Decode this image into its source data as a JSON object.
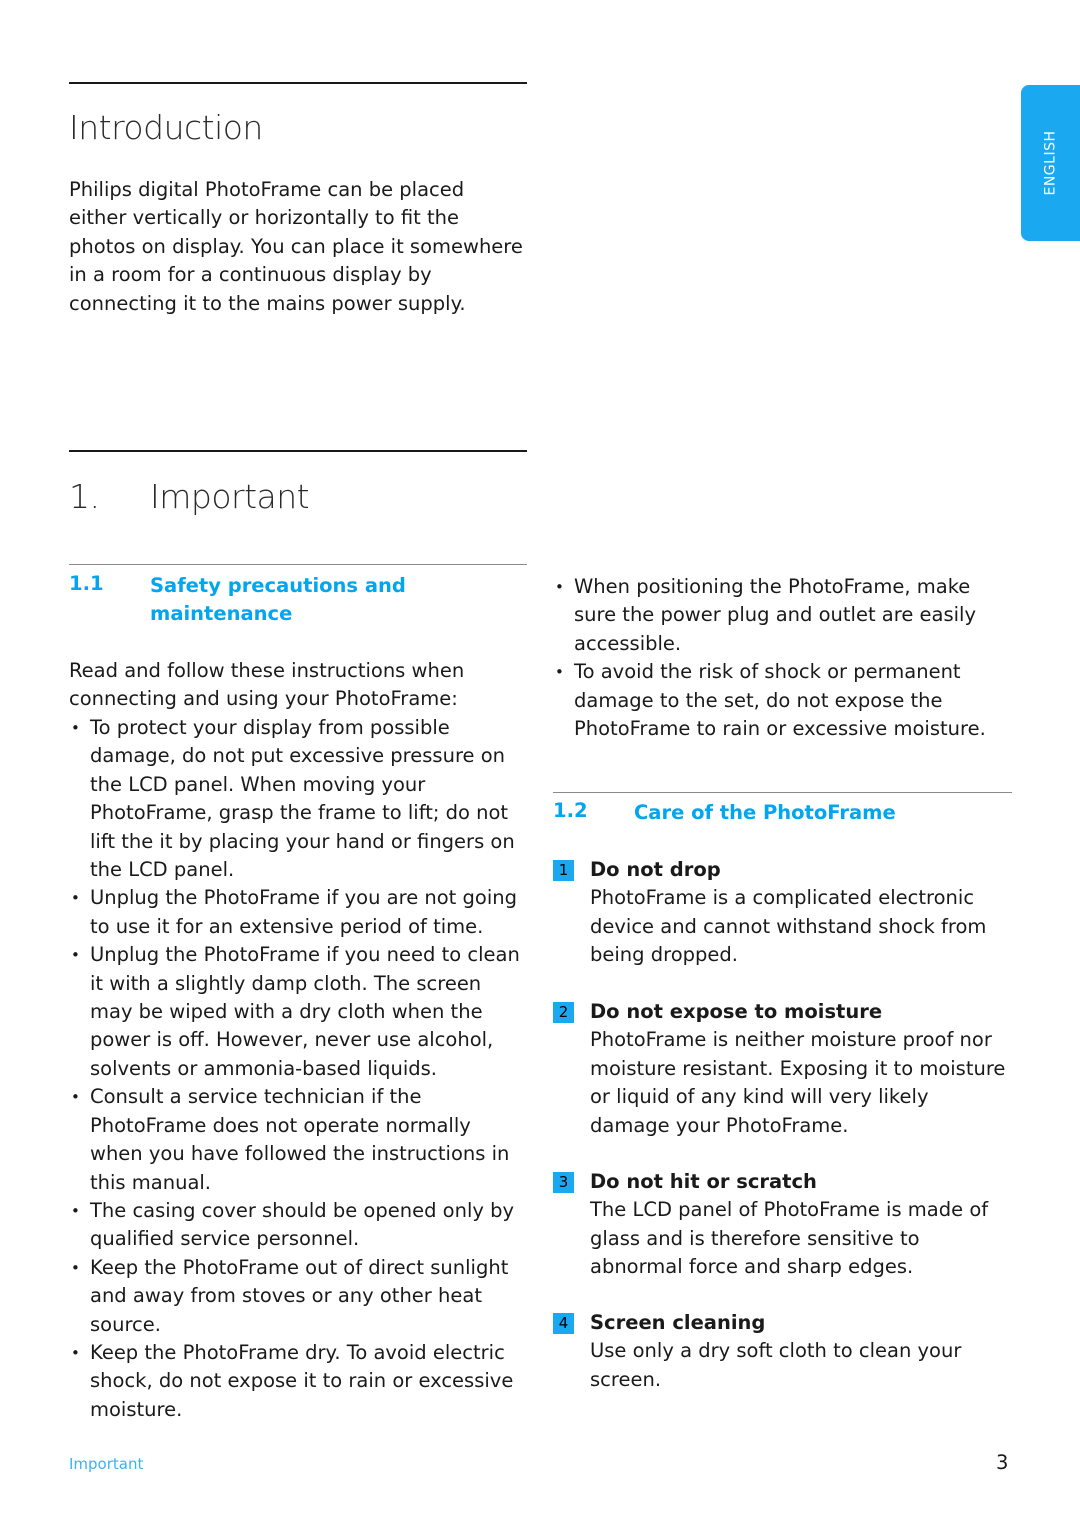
{
  "side_tab": {
    "label": "ENGLISH"
  },
  "introduction": {
    "title": "Introduction",
    "body": "Philips digital PhotoFrame can be placed either vertically or horizontally to fit the photos on display. You can place it somewhere in a room for a continuous display by connecting it to the mains power supply."
  },
  "chapter": {
    "number": "1.",
    "title": "Important"
  },
  "section_1_1": {
    "number": "1.1",
    "title": "Safety precautions and maintenance",
    "intro": "Read and follow these instructions when connecting and using your PhotoFrame:",
    "bullets": [
      "To protect your display from possible damage, do not put excessive pressure on the LCD panel. When moving your PhotoFrame, grasp the frame to lift; do not lift the it by placing your hand or fingers on the LCD panel.",
      "Unplug the PhotoFrame if you are not going to use it for an extensive period of time.",
      "Unplug the PhotoFrame if you need to clean it with a slightly damp cloth. The screen may be wiped with a dry cloth when the power is off. However, never use alcohol, solvents or ammonia-based liquids.",
      "Consult a service technician if the PhotoFrame does not operate normally when you have followed the instructions in this manual.",
      "The casing cover should be opened only by qualified service personnel.",
      "Keep the PhotoFrame out of direct sunlight and away from stoves or any other heat source.",
      "Keep the PhotoFrame dry. To avoid electric shock, do not expose it to rain or excessive moisture."
    ],
    "bullets_continued": [
      "When positioning the PhotoFrame, make sure the power plug and outlet are easily accessible.",
      "To avoid the risk of shock or permanent damage to the set, do not expose the PhotoFrame to rain or excessive moisture."
    ]
  },
  "section_1_2": {
    "number": "1.2",
    "title": "Care of the PhotoFrame",
    "items": [
      {
        "num": "1",
        "title": "Do not drop",
        "body": "PhotoFrame is a complicated electronic device and cannot withstand shock from being dropped."
      },
      {
        "num": "2",
        "title": "Do not expose to moisture",
        "body": "PhotoFrame is neither moisture proof nor moisture resistant. Exposing it to moisture or liquid of any kind will very likely damage your PhotoFrame."
      },
      {
        "num": "3",
        "title": "Do not hit or scratch",
        "body": "The LCD panel of PhotoFrame is made of glass and is therefore sensitive to abnormal force and sharp edges."
      },
      {
        "num": "4",
        "title": "Screen cleaning",
        "body": "Use only a dry soft cloth to clean your screen."
      }
    ]
  },
  "footer": {
    "section_label": "Important",
    "page_number": "3"
  }
}
